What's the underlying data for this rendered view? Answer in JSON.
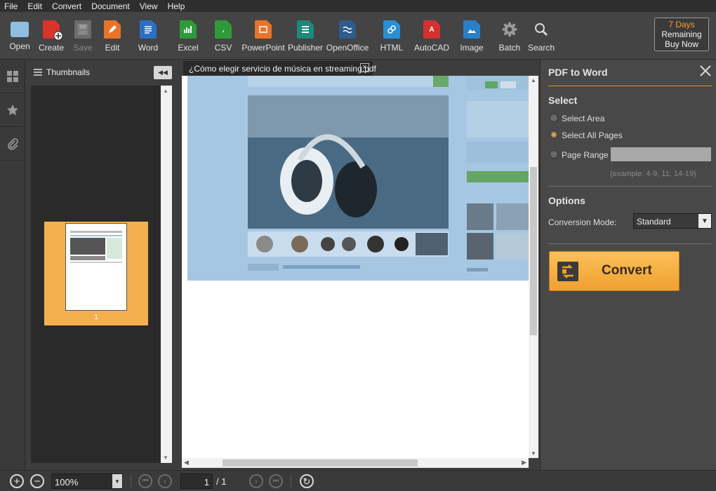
{
  "menu": [
    "File",
    "Edit",
    "Convert",
    "Document",
    "View",
    "Help"
  ],
  "toolbar": {
    "open": "Open",
    "create": "Create",
    "save": "Save",
    "edit": "Edit",
    "word": "Word",
    "excel": "Excel",
    "csv": "CSV",
    "powerpoint": "PowerPoint",
    "publisher": "Publisher",
    "openoffice": "OpenOffice",
    "html": "HTML",
    "autocad": "AutoCAD",
    "image": "Image",
    "batch": "Batch",
    "search": "Search"
  },
  "trial": {
    "days": "7 Days",
    "remaining": "Remaining",
    "buy": "Buy Now"
  },
  "thumbnails": {
    "title": "Thumbnails",
    "page_number": "1"
  },
  "document": {
    "tab_title": "¿Cómo elegir servicio de música en streaming.pdf"
  },
  "panel": {
    "title": "PDF to Word",
    "select_heading": "Select",
    "select_area": "Select Area",
    "select_all_pages": "Select All Pages",
    "page_range": "Page Range",
    "page_range_value": "",
    "example": "(example: 4-9, 11, 14-19)",
    "options_heading": "Options",
    "conversion_mode_label": "Conversion Mode:",
    "conversion_mode_value": "Standard",
    "convert_label": "Convert"
  },
  "status": {
    "zoom": "100%",
    "current_page": "1",
    "total_pages": "/ 1"
  },
  "colors": {
    "accent": "#f0a030",
    "overlay": "#a6c7e2"
  }
}
